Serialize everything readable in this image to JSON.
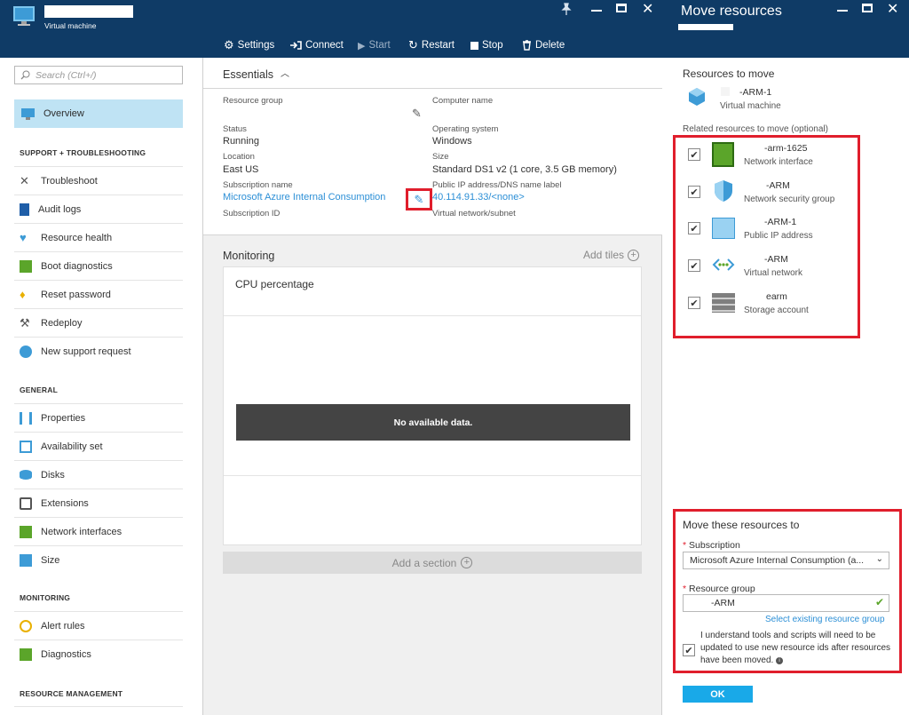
{
  "vm_header": {
    "subtitle": "Virtual machine",
    "toolbar": [
      {
        "label": "Settings",
        "icon": "gear-icon",
        "enabled": true
      },
      {
        "label": "Connect",
        "icon": "connect-icon",
        "enabled": true
      },
      {
        "label": "Start",
        "icon": "play-icon",
        "enabled": false
      },
      {
        "label": "Restart",
        "icon": "restart-icon",
        "enabled": true
      },
      {
        "label": "Stop",
        "icon": "stop-icon",
        "enabled": true
      },
      {
        "label": "Delete",
        "icon": "trash-icon",
        "enabled": true
      }
    ]
  },
  "left_nav": {
    "search_placeholder": "Search (Ctrl+/)",
    "overview": "Overview",
    "section_support": "SUPPORT + TROUBLESHOOTING",
    "support_items": [
      "Troubleshoot",
      "Audit logs",
      "Resource health",
      "Boot diagnostics",
      "Reset password",
      "Redeploy",
      "New support request"
    ],
    "section_general": "GENERAL",
    "general_items": [
      "Properties",
      "Availability set",
      "Disks",
      "Extensions",
      "Network interfaces",
      "Size"
    ],
    "section_monitoring": "MONITORING",
    "monitoring_items": [
      "Alert rules",
      "Diagnostics"
    ],
    "section_resource": "RESOURCE MANAGEMENT"
  },
  "essentials": {
    "title": "Essentials",
    "resource_group_label": "Resource group",
    "computer_name_label": "Computer name",
    "status_label": "Status",
    "status_value": "Running",
    "os_label": "Operating system",
    "os_value": "Windows",
    "location_label": "Location",
    "location_value": "East US",
    "size_label": "Size",
    "size_value": "Standard DS1 v2 (1 core, 3.5 GB memory)",
    "subscription_name_label": "Subscription name",
    "subscription_name_value": "Microsoft Azure Internal Consumption",
    "public_ip_label": "Public IP address/DNS name label",
    "public_ip_value": "40.114.91.33/<none>",
    "subscription_id_label": "Subscription ID",
    "vnet_label": "Virtual network/subnet"
  },
  "monitoring": {
    "title": "Monitoring",
    "add_tiles": "Add tiles",
    "cpu_title": "CPU percentage",
    "no_data": "No available data.",
    "add_section": "Add a section"
  },
  "move_panel": {
    "title": "Move resources",
    "resources_to_move": "Resources to move",
    "vm_name": "-ARM-1",
    "vm_type": "Virtual machine",
    "related_label": "Related resources to move (optional)",
    "related": [
      {
        "name": "-arm-1625",
        "type": "Network interface",
        "checked": true,
        "icon": "network-interface-icon"
      },
      {
        "name": "-ARM",
        "type": "Network security group",
        "checked": true,
        "icon": "shield-icon"
      },
      {
        "name": "-ARM-1",
        "type": "Public IP address",
        "checked": true,
        "icon": "public-ip-icon"
      },
      {
        "name": "-ARM",
        "type": "Virtual network",
        "checked": true,
        "icon": "virtual-network-icon"
      },
      {
        "name": "earm",
        "type": "Storage account",
        "checked": true,
        "icon": "storage-icon"
      }
    ],
    "move_to_title": "Move these resources to",
    "subscription_label": "Subscription",
    "subscription_value": "Microsoft Azure Internal Consumption (a...",
    "resource_group_label": "Resource group",
    "resource_group_value": "-ARM",
    "select_existing": "Select existing resource group",
    "understand_text": "I understand tools and scripts will need to be updated to use new resource ids after resources have been moved.",
    "ok": "OK"
  },
  "colors": {
    "header": "#0f3b66",
    "accent": "#2c8fd6",
    "highlight": "#e01e2c",
    "ok_button": "#19a9e8"
  }
}
